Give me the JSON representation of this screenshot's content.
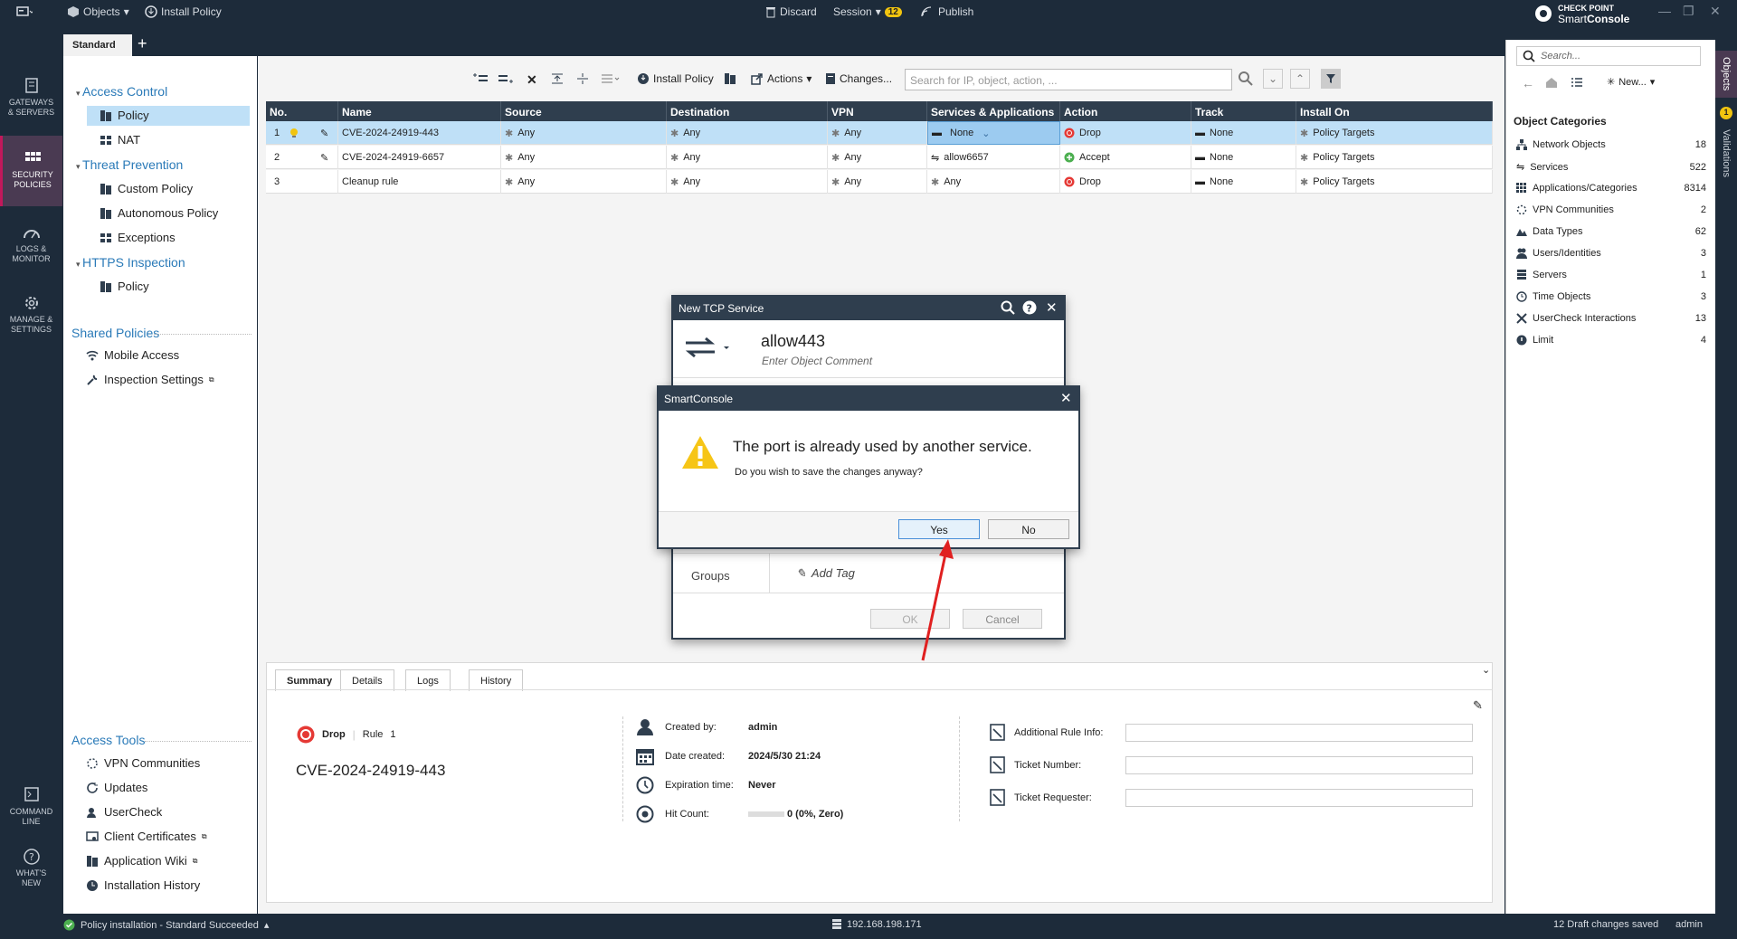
{
  "topbar": {
    "objects": "Objects",
    "install_policy": "Install Policy",
    "discard": "Discard",
    "session": "Session",
    "session_count": "12",
    "publish": "Publish",
    "brand_top": "CHECK POINT",
    "brand_smart": "Smart",
    "brand_console": "Console"
  },
  "tabs": {
    "standard": "Standard",
    "add": "+"
  },
  "rail": {
    "gateways": [
      "GATEWAYS",
      "& SERVERS"
    ],
    "security": [
      "SECURITY",
      "POLICIES"
    ],
    "logs": [
      "LOGS &",
      "MONITOR"
    ],
    "manage": [
      "MANAGE &",
      "SETTINGS"
    ],
    "command": [
      "COMMAND",
      "LINE"
    ],
    "whatsnew": [
      "WHAT'S",
      "NEW"
    ]
  },
  "nav": {
    "access_control": "Access Control",
    "policy": "Policy",
    "nat": "NAT",
    "threat_prevention": "Threat Prevention",
    "custom_policy": "Custom Policy",
    "autonomous_policy": "Autonomous Policy",
    "exceptions": "Exceptions",
    "https_inspection": "HTTPS Inspection",
    "https_policy": "Policy",
    "shared_policies": "Shared Policies",
    "mobile_access": "Mobile Access",
    "inspection_settings": "Inspection Settings",
    "access_tools": "Access Tools",
    "vpn_communities": "VPN Communities",
    "updates": "Updates",
    "usercheck": "UserCheck",
    "client_certificates": "Client Certificates",
    "application_wiki": "Application Wiki",
    "installation_history": "Installation History"
  },
  "toolbar": {
    "install_policy": "Install Policy",
    "actions": "Actions",
    "changes": "Changes...",
    "search_placeholder": "Search for IP, object, action, ..."
  },
  "table": {
    "headers": [
      "No.",
      "Name",
      "Source",
      "Destination",
      "VPN",
      "Services & Applications",
      "Action",
      "Track",
      "Install On"
    ],
    "rows": [
      {
        "no": "1",
        "name": "CVE-2024-24919-443",
        "source": "Any",
        "destination": "Any",
        "vpn": "Any",
        "services": "None",
        "action": "Drop",
        "track": "None",
        "install_on": "Policy Targets"
      },
      {
        "no": "2",
        "name": "CVE-2024-24919-6657",
        "source": "Any",
        "destination": "Any",
        "vpn": "Any",
        "services": "allow6657",
        "action": "Accept",
        "track": "None",
        "install_on": "Policy Targets"
      },
      {
        "no": "3",
        "name": "Cleanup rule",
        "source": "Any",
        "destination": "Any",
        "vpn": "Any",
        "services": "Any",
        "action": "Drop",
        "track": "None",
        "install_on": "Policy Targets"
      }
    ]
  },
  "detail": {
    "tabs": [
      "Summary",
      "Details",
      "Logs",
      "History"
    ],
    "action": "Drop",
    "rule_label": "Rule",
    "rule_no": "1",
    "rule_name": "CVE-2024-24919-443",
    "created_by_label": "Created by:",
    "created_by": "admin",
    "date_created_label": "Date created:",
    "date_created": "2024/5/30 21:24",
    "expiration_label": "Expiration time:",
    "expiration": "Never",
    "hit_count_label": "Hit Count:",
    "hit_count": "0 (0%, Zero)",
    "additional_info_label": "Additional Rule Info:",
    "ticket_number_label": "Ticket Number:",
    "ticket_requester_label": "Ticket Requester:"
  },
  "right": {
    "search_placeholder": "Search...",
    "new": "New...",
    "heading": "Object Categories",
    "categories": [
      {
        "label": "Network Objects",
        "count": "18"
      },
      {
        "label": "Services",
        "count": "522"
      },
      {
        "label": "Applications/Categories",
        "count": "8314"
      },
      {
        "label": "VPN Communities",
        "count": "2"
      },
      {
        "label": "Data Types",
        "count": "62"
      },
      {
        "label": "Users/Identities",
        "count": "3"
      },
      {
        "label": "Servers",
        "count": "1"
      },
      {
        "label": "Time Objects",
        "count": "3"
      },
      {
        "label": "UserCheck Interactions",
        "count": "13"
      },
      {
        "label": "Limit",
        "count": "4"
      }
    ],
    "strip_objects": "Objects",
    "strip_validations": "Validations",
    "strip_badge": "1"
  },
  "status": {
    "install_msg": "Policy installation - Standard Succeeded",
    "server_ip": "192.168.198.171",
    "draft": "12 Draft changes saved",
    "user": "admin"
  },
  "tcp_dialog": {
    "title": "New TCP Service",
    "name": "allow443",
    "comment_placeholder": "Enter Object Comment",
    "groups": "Groups",
    "add_tag": "Add Tag",
    "ok": "OK",
    "cancel": "Cancel"
  },
  "alert": {
    "title": "SmartConsole",
    "heading": "The port is already used by another service.",
    "message": "Do you wish to save the changes anyway?",
    "yes": "Yes",
    "no": "No"
  },
  "colors": {
    "dark": "#1d2b3a",
    "header": "#2f3e4e",
    "accent_blue": "#2a7ab8",
    "selected": "#bfe0f7",
    "drop_red": "#e53935",
    "accept_green": "#4caf50",
    "arrow_red": "#e02020"
  }
}
